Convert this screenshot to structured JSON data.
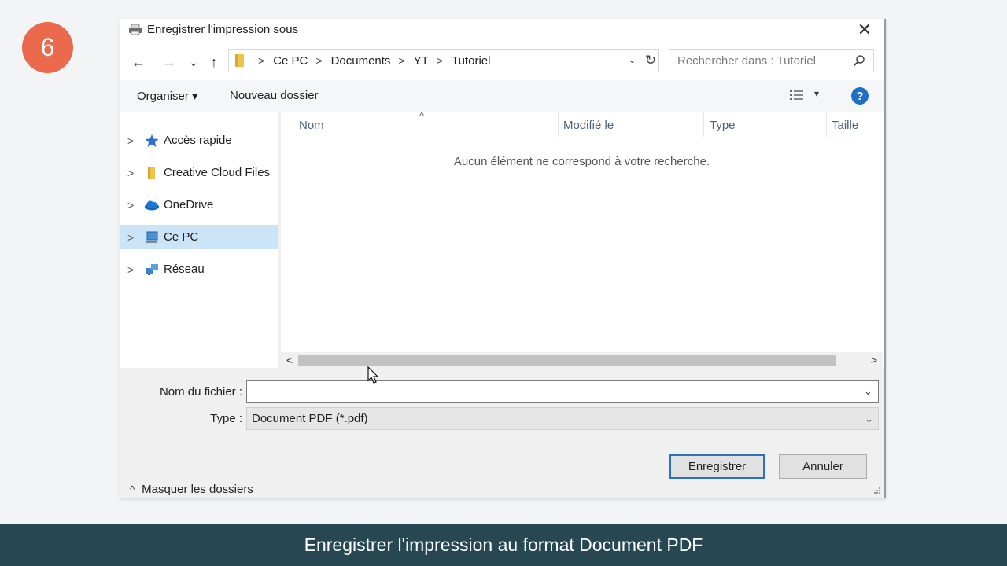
{
  "step_number": "6",
  "dialog": {
    "title": "Enregistrer l'impression sous",
    "close_label": "✕"
  },
  "nav": {
    "back_label": "←",
    "forward_label": "→",
    "recent_label": "⌄",
    "up_label": "↑"
  },
  "address": {
    "crumbs": [
      "Ce PC",
      "Documents",
      "YT",
      "Tutoriel"
    ],
    "separator": ">",
    "dropdown_label": "⌄",
    "refresh_label": "↻"
  },
  "search": {
    "placeholder": "Rechercher dans : Tutoriel"
  },
  "toolbar": {
    "organize_label": "Organiser ▾",
    "new_folder_label": "Nouveau dossier",
    "view_dropdown_label": "▾",
    "help_label": "?"
  },
  "sidebar": {
    "items": [
      {
        "label": "Accès rapide",
        "icon": "star-icon",
        "selected": false
      },
      {
        "label": "Creative Cloud Files",
        "icon": "folder-icon",
        "selected": false
      },
      {
        "label": "OneDrive",
        "icon": "cloud-icon",
        "selected": false
      },
      {
        "label": "Ce PC",
        "icon": "computer-icon",
        "selected": true
      },
      {
        "label": "Réseau",
        "icon": "network-icon",
        "selected": false
      }
    ],
    "chevron": ">"
  },
  "filelist": {
    "columns": [
      "Nom",
      "Modifié le",
      "Type",
      "Taille"
    ],
    "sort_caret": "^",
    "empty_message": "Aucun élément ne correspond à votre recherche."
  },
  "scrollbar": {
    "left_label": "<",
    "right_label": ">"
  },
  "form": {
    "filename_label": "Nom du fichier :",
    "filename_value": "",
    "filename_dropdown": "⌄",
    "type_label": "Type :",
    "type_value": "Document PDF (*.pdf)",
    "type_dropdown": "⌄"
  },
  "footer": {
    "hide_folders_caret": "^",
    "hide_folders_label": "Masquer les dossiers",
    "save_label": "Enregistrer",
    "cancel_label": "Annuler"
  },
  "caption": "Enregistrer l'impression au format Document PDF",
  "colors": {
    "badge": "#ec6a4c",
    "caption_bar": "#274753",
    "selection": "#cce4f7",
    "help": "#1f6fc6"
  }
}
